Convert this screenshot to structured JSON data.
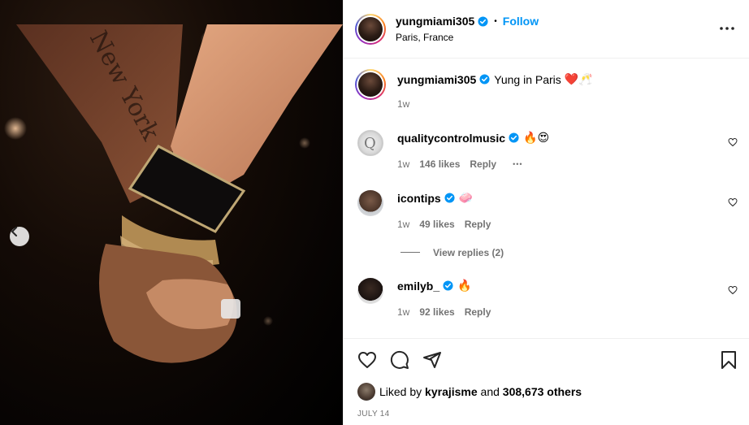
{
  "post": {
    "username": "yungmiami305",
    "location": "Paris, France",
    "follow_label": "Follow",
    "more_icon": "more-horizontal-icon",
    "caption": "Yung in Paris",
    "caption_emoji": "❤️🥂",
    "caption_time": "1w"
  },
  "comments": [
    {
      "username": "quality​controlmusic",
      "text": "🔥😍",
      "time": "1w",
      "likes": "146 likes",
      "reply_label": "Reply",
      "more": "•••"
    },
    {
      "username": "icontips",
      "text": "🧼",
      "time": "1w",
      "likes": "49 likes",
      "reply_label": "Reply",
      "view_replies": "View replies (2)"
    },
    {
      "username": "emilyb_",
      "text": "🔥",
      "time": "1w",
      "likes": "92 likes",
      "reply_label": "Reply"
    }
  ],
  "footer": {
    "liked_by_prefix": "Liked by",
    "liked_by_user": "kyrajisme",
    "and": "and",
    "others": "308,673 others",
    "date": "JULY 14"
  },
  "colors": {
    "accent": "#0095f6",
    "verified": "#0095f6",
    "muted": "#737373",
    "divider": "#efefef"
  }
}
